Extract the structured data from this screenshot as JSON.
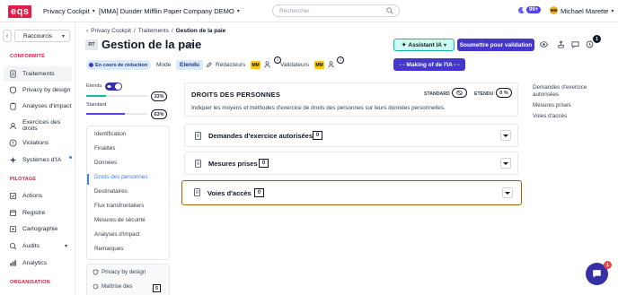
{
  "header": {
    "logo": "eqs",
    "product_label": "Privacy Cockpit",
    "company_label": "[MMA] Dunder Mifflin Paper Company DEMO",
    "search_placeholder": "Rechercher",
    "notif_count": "99+",
    "user_initials": "MM",
    "user_name": "Michael Marette"
  },
  "sidebar": {
    "shortcut": "Raccourcis",
    "sections": [
      {
        "title": "CONFORMITÉ",
        "items": [
          "Traitements",
          "Privacy by design",
          "Analyses d'impact",
          "Exercices des droits",
          "Violations",
          "Systèmes d'IA"
        ]
      },
      {
        "title": "PILOTAGE",
        "items": [
          "Actions",
          "Registre",
          "Cartographie",
          "Audits",
          "Analytics"
        ]
      },
      {
        "title": "ORGANISATION",
        "items": []
      }
    ]
  },
  "breadcrumb": [
    "Privacy Cockpit",
    "Traitements",
    "Gestion de la paie"
  ],
  "page": {
    "badge": "RT",
    "title": "Gestion de la paie",
    "status": "En cours de réduction",
    "mode_label": "Mode",
    "mode_value": "Etendu",
    "redacteurs_label": "Rédacteurs",
    "validateurs_label": "Validateurs",
    "avatar_initials": "MM",
    "ia_button": "Assistant IA",
    "submit_button": "Soumettre pour validation",
    "making_button": "- - Making of de l'IA - -",
    "notif_count": "1"
  },
  "progress": {
    "etendu_label": "Etendu",
    "standard_label": "Standard",
    "etendu_pct": "33%",
    "etendu_value": 33,
    "standard_pct": "63%",
    "standard_value": 63,
    "etendu_color": "#14b8a6",
    "standard_color": "#4f46e5"
  },
  "sections_nav": [
    "Identification",
    "Finalités",
    "Données",
    "Droits des personnes",
    "Destinataires",
    "Flux transfrontaliers",
    "Mesures de sécurité",
    "Analyses d'impact",
    "Remarques"
  ],
  "sub_nav": {
    "item1": "Privacy by design",
    "item2": "Maîtrise des",
    "item2_count": "5"
  },
  "droits": {
    "title": "DROITS DES PERSONNES",
    "description": "Indiquer les moyens et méthodes d'exercice de droits des personnes sur leurs données personnelles.",
    "standard_label": "STANDARD",
    "etendu_label": "ETENDU",
    "etendu_value": "0 %"
  },
  "accordions": [
    {
      "title": "Demandes d'exercice autorisées",
      "count": "0"
    },
    {
      "title": "Mesures prises",
      "count": "0"
    },
    {
      "title": "Voies d'accès",
      "count": "0"
    }
  ],
  "toc": [
    "Demandes d'exercice autorisées",
    "Mesures prises",
    "Voies d'accès"
  ],
  "chat_badge": "1"
}
